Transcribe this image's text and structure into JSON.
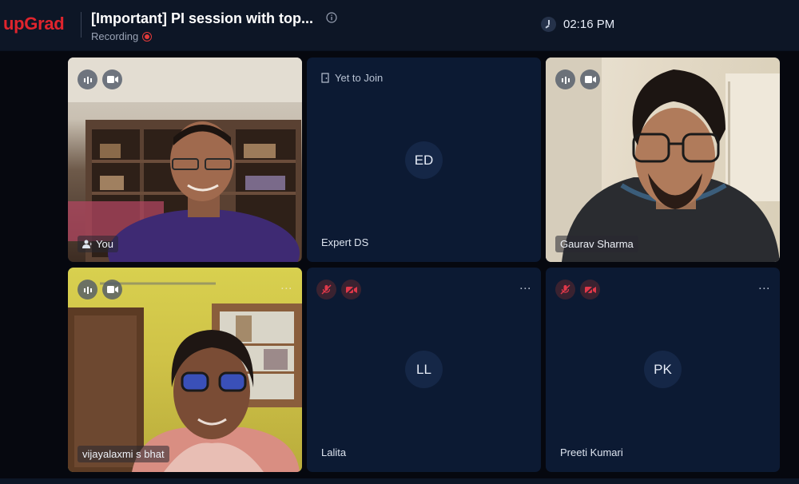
{
  "header": {
    "logo": "upGrad",
    "title": "[Important] PI session with top...",
    "recording_label": "Recording",
    "time": "02:16 PM"
  },
  "tiles": [
    {
      "name": "You",
      "type": "video",
      "mic": "on",
      "camera": "on"
    },
    {
      "name": "Expert DS",
      "type": "avatar",
      "initials": "ED",
      "status": "Yet to Join"
    },
    {
      "name": "Gaurav Sharma",
      "type": "video",
      "mic": "on",
      "camera": "on"
    },
    {
      "name": "vijayalaxmi s bhat",
      "type": "video",
      "mic": "on",
      "camera": "on",
      "menu": "..."
    },
    {
      "name": "Lalita",
      "type": "avatar",
      "initials": "LL",
      "mic": "off",
      "camera": "off",
      "menu": "..."
    },
    {
      "name": "Preeti Kumari",
      "type": "avatar",
      "initials": "PK",
      "mic": "off",
      "camera": "off",
      "menu": "..."
    }
  ],
  "colors": {
    "brand": "#e0242d",
    "tile_bg": "#0c1a33",
    "recording": "#e23a3a"
  }
}
